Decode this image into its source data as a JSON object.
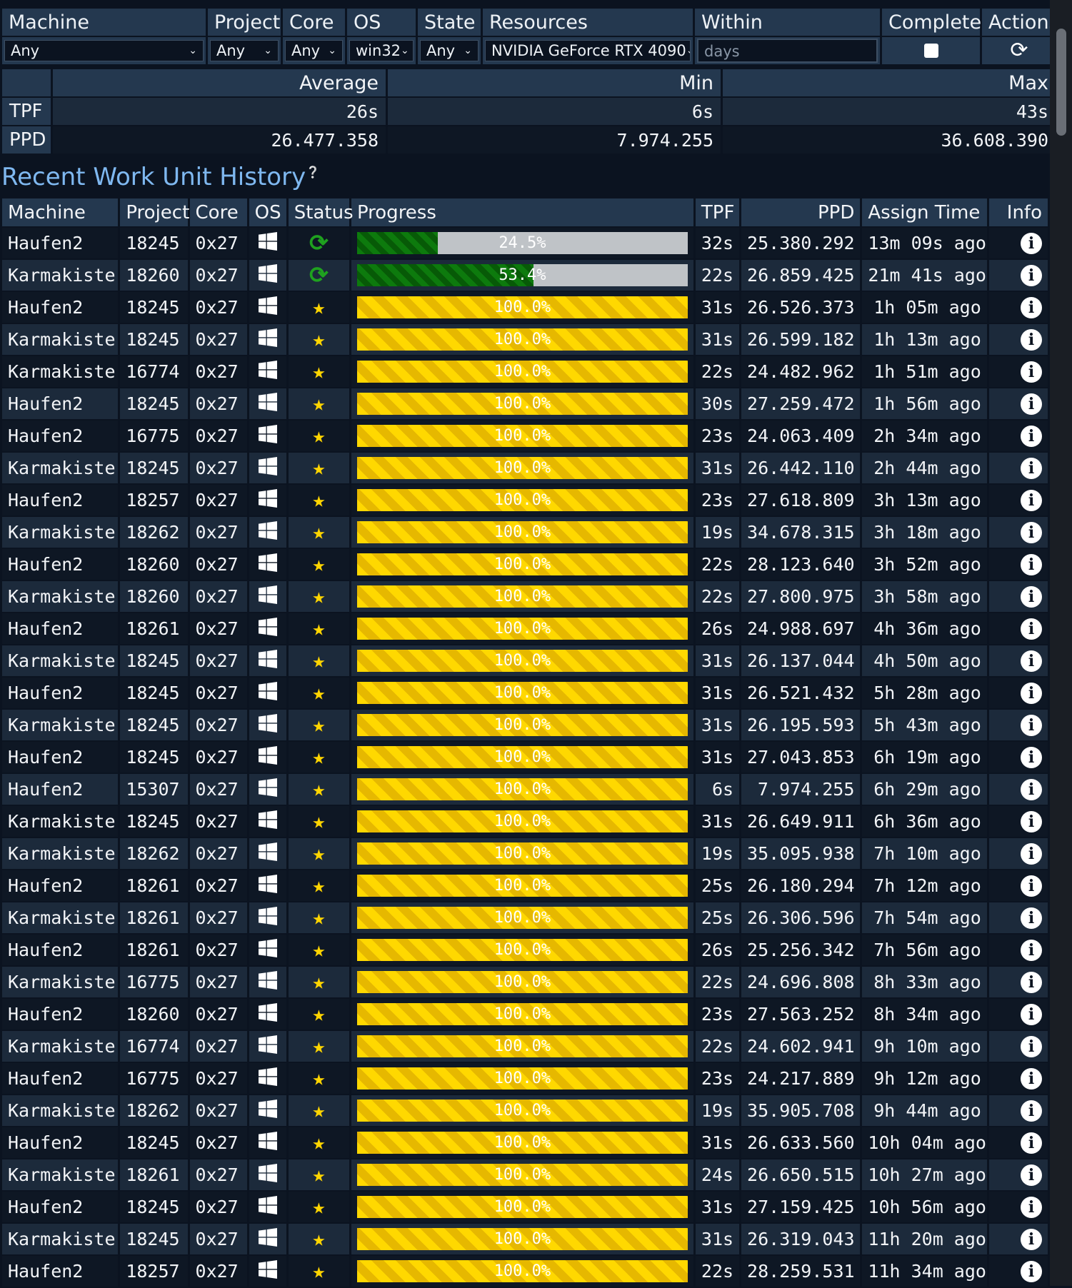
{
  "filters": {
    "headers": [
      "Machine",
      "Project",
      "Core",
      "OS",
      "State",
      "Resources",
      "Within",
      "Complete",
      "Actions"
    ],
    "values": [
      "Any",
      "Any",
      "Any",
      "win32",
      "Any",
      "NVIDIA GeForce RTX 4090"
    ],
    "days_placeholder": "days"
  },
  "stats": {
    "headers": [
      "Average",
      "Min",
      "Max"
    ],
    "tpf": {
      "label": "TPF",
      "average": "26s",
      "min": "6s",
      "max": "43s"
    },
    "ppd": {
      "label": "PPD",
      "average": "26.477.358",
      "min": "7.974.255",
      "max": "36.608.390"
    }
  },
  "history": {
    "title": "Recent Work Unit History",
    "headers": [
      "Machine",
      "Project",
      "Core",
      "OS",
      "Status",
      "Progress",
      "TPF",
      "PPD",
      "Assign Time",
      "Info"
    ],
    "rows": [
      {
        "machine": "Haufen2",
        "project": "18245",
        "core": "0x27",
        "status": "running",
        "progress": 24.5,
        "progress_label": "24.5%",
        "tpf": "32s",
        "ppd": "25.380.292",
        "assign": "13m 09s ago"
      },
      {
        "machine": "Karmakiste",
        "project": "18260",
        "core": "0x27",
        "status": "running",
        "progress": 53.4,
        "progress_label": "53.4%",
        "tpf": "22s",
        "ppd": "26.859.425",
        "assign": "21m 41s ago"
      },
      {
        "machine": "Haufen2",
        "project": "18245",
        "core": "0x27",
        "status": "complete",
        "progress": 100,
        "progress_label": "100.0%",
        "tpf": "31s",
        "ppd": "26.526.373",
        "assign": "1h 05m ago"
      },
      {
        "machine": "Karmakiste",
        "project": "18245",
        "core": "0x27",
        "status": "complete",
        "progress": 100,
        "progress_label": "100.0%",
        "tpf": "31s",
        "ppd": "26.599.182",
        "assign": "1h 13m ago"
      },
      {
        "machine": "Karmakiste",
        "project": "16774",
        "core": "0x27",
        "status": "complete",
        "progress": 100,
        "progress_label": "100.0%",
        "tpf": "22s",
        "ppd": "24.482.962",
        "assign": "1h 51m ago"
      },
      {
        "machine": "Haufen2",
        "project": "18245",
        "core": "0x27",
        "status": "complete",
        "progress": 100,
        "progress_label": "100.0%",
        "tpf": "30s",
        "ppd": "27.259.472",
        "assign": "1h 56m ago"
      },
      {
        "machine": "Haufen2",
        "project": "16775",
        "core": "0x27",
        "status": "complete",
        "progress": 100,
        "progress_label": "100.0%",
        "tpf": "23s",
        "ppd": "24.063.409",
        "assign": "2h 34m ago"
      },
      {
        "machine": "Karmakiste",
        "project": "18245",
        "core": "0x27",
        "status": "complete",
        "progress": 100,
        "progress_label": "100.0%",
        "tpf": "31s",
        "ppd": "26.442.110",
        "assign": "2h 44m ago"
      },
      {
        "machine": "Haufen2",
        "project": "18257",
        "core": "0x27",
        "status": "complete",
        "progress": 100,
        "progress_label": "100.0%",
        "tpf": "23s",
        "ppd": "27.618.809",
        "assign": "3h 13m ago"
      },
      {
        "machine": "Karmakiste",
        "project": "18262",
        "core": "0x27",
        "status": "complete",
        "progress": 100,
        "progress_label": "100.0%",
        "tpf": "19s",
        "ppd": "34.678.315",
        "assign": "3h 18m ago"
      },
      {
        "machine": "Haufen2",
        "project": "18260",
        "core": "0x27",
        "status": "complete",
        "progress": 100,
        "progress_label": "100.0%",
        "tpf": "22s",
        "ppd": "28.123.640",
        "assign": "3h 52m ago"
      },
      {
        "machine": "Karmakiste",
        "project": "18260",
        "core": "0x27",
        "status": "complete",
        "progress": 100,
        "progress_label": "100.0%",
        "tpf": "22s",
        "ppd": "27.800.975",
        "assign": "3h 58m ago"
      },
      {
        "machine": "Haufen2",
        "project": "18261",
        "core": "0x27",
        "status": "complete",
        "progress": 100,
        "progress_label": "100.0%",
        "tpf": "26s",
        "ppd": "24.988.697",
        "assign": "4h 36m ago"
      },
      {
        "machine": "Karmakiste",
        "project": "18245",
        "core": "0x27",
        "status": "complete",
        "progress": 100,
        "progress_label": "100.0%",
        "tpf": "31s",
        "ppd": "26.137.044",
        "assign": "4h 50m ago"
      },
      {
        "machine": "Haufen2",
        "project": "18245",
        "core": "0x27",
        "status": "complete",
        "progress": 100,
        "progress_label": "100.0%",
        "tpf": "31s",
        "ppd": "26.521.432",
        "assign": "5h 28m ago"
      },
      {
        "machine": "Karmakiste",
        "project": "18245",
        "core": "0x27",
        "status": "complete",
        "progress": 100,
        "progress_label": "100.0%",
        "tpf": "31s",
        "ppd": "26.195.593",
        "assign": "5h 43m ago"
      },
      {
        "machine": "Haufen2",
        "project": "18245",
        "core": "0x27",
        "status": "complete",
        "progress": 100,
        "progress_label": "100.0%",
        "tpf": "31s",
        "ppd": "27.043.853",
        "assign": "6h 19m ago"
      },
      {
        "machine": "Haufen2",
        "project": "15307",
        "core": "0x27",
        "status": "complete",
        "progress": 100,
        "progress_label": "100.0%",
        "tpf": "6s",
        "ppd": "7.974.255",
        "assign": "6h 29m ago"
      },
      {
        "machine": "Karmakiste",
        "project": "18245",
        "core": "0x27",
        "status": "complete",
        "progress": 100,
        "progress_label": "100.0%",
        "tpf": "31s",
        "ppd": "26.649.911",
        "assign": "6h 36m ago"
      },
      {
        "machine": "Karmakiste",
        "project": "18262",
        "core": "0x27",
        "status": "complete",
        "progress": 100,
        "progress_label": "100.0%",
        "tpf": "19s",
        "ppd": "35.095.938",
        "assign": "7h 10m ago"
      },
      {
        "machine": "Haufen2",
        "project": "18261",
        "core": "0x27",
        "status": "complete",
        "progress": 100,
        "progress_label": "100.0%",
        "tpf": "25s",
        "ppd": "26.180.294",
        "assign": "7h 12m ago"
      },
      {
        "machine": "Karmakiste",
        "project": "18261",
        "core": "0x27",
        "status": "complete",
        "progress": 100,
        "progress_label": "100.0%",
        "tpf": "25s",
        "ppd": "26.306.596",
        "assign": "7h 54m ago"
      },
      {
        "machine": "Haufen2",
        "project": "18261",
        "core": "0x27",
        "status": "complete",
        "progress": 100,
        "progress_label": "100.0%",
        "tpf": "26s",
        "ppd": "25.256.342",
        "assign": "7h 56m ago"
      },
      {
        "machine": "Karmakiste",
        "project": "16775",
        "core": "0x27",
        "status": "complete",
        "progress": 100,
        "progress_label": "100.0%",
        "tpf": "22s",
        "ppd": "24.696.808",
        "assign": "8h 33m ago"
      },
      {
        "machine": "Haufen2",
        "project": "18260",
        "core": "0x27",
        "status": "complete",
        "progress": 100,
        "progress_label": "100.0%",
        "tpf": "23s",
        "ppd": "27.563.252",
        "assign": "8h 34m ago"
      },
      {
        "machine": "Karmakiste",
        "project": "16774",
        "core": "0x27",
        "status": "complete",
        "progress": 100,
        "progress_label": "100.0%",
        "tpf": "22s",
        "ppd": "24.602.941",
        "assign": "9h 10m ago"
      },
      {
        "machine": "Haufen2",
        "project": "16775",
        "core": "0x27",
        "status": "complete",
        "progress": 100,
        "progress_label": "100.0%",
        "tpf": "23s",
        "ppd": "24.217.889",
        "assign": "9h 12m ago"
      },
      {
        "machine": "Karmakiste",
        "project": "18262",
        "core": "0x27",
        "status": "complete",
        "progress": 100,
        "progress_label": "100.0%",
        "tpf": "19s",
        "ppd": "35.905.708",
        "assign": "9h 44m ago"
      },
      {
        "machine": "Haufen2",
        "project": "18245",
        "core": "0x27",
        "status": "complete",
        "progress": 100,
        "progress_label": "100.0%",
        "tpf": "31s",
        "ppd": "26.633.560",
        "assign": "10h 04m ago"
      },
      {
        "machine": "Karmakiste",
        "project": "18261",
        "core": "0x27",
        "status": "complete",
        "progress": 100,
        "progress_label": "100.0%",
        "tpf": "24s",
        "ppd": "26.650.515",
        "assign": "10h 27m ago"
      },
      {
        "machine": "Haufen2",
        "project": "18245",
        "core": "0x27",
        "status": "complete",
        "progress": 100,
        "progress_label": "100.0%",
        "tpf": "31s",
        "ppd": "27.159.425",
        "assign": "10h 56m ago"
      },
      {
        "machine": "Karmakiste",
        "project": "18245",
        "core": "0x27",
        "status": "complete",
        "progress": 100,
        "progress_label": "100.0%",
        "tpf": "31s",
        "ppd": "26.319.043",
        "assign": "11h 20m ago"
      },
      {
        "machine": "Haufen2",
        "project": "18257",
        "core": "0x27",
        "status": "complete",
        "progress": 100,
        "progress_label": "100.0%",
        "tpf": "22s",
        "ppd": "28.259.531",
        "assign": "11h 34m ago"
      }
    ]
  },
  "icons": {
    "os": "windows-icon",
    "running": "refresh-icon",
    "complete": "star-icon",
    "info": "info-icon",
    "actions": "refresh-icon",
    "help": "help-icon"
  },
  "colors": {
    "background": "#0b1320",
    "header": "#24384f",
    "accent_text": "#7fb8f0",
    "progress_running": "#0d7a0d",
    "progress_done": "#ffd800",
    "star": "#ffd500"
  }
}
